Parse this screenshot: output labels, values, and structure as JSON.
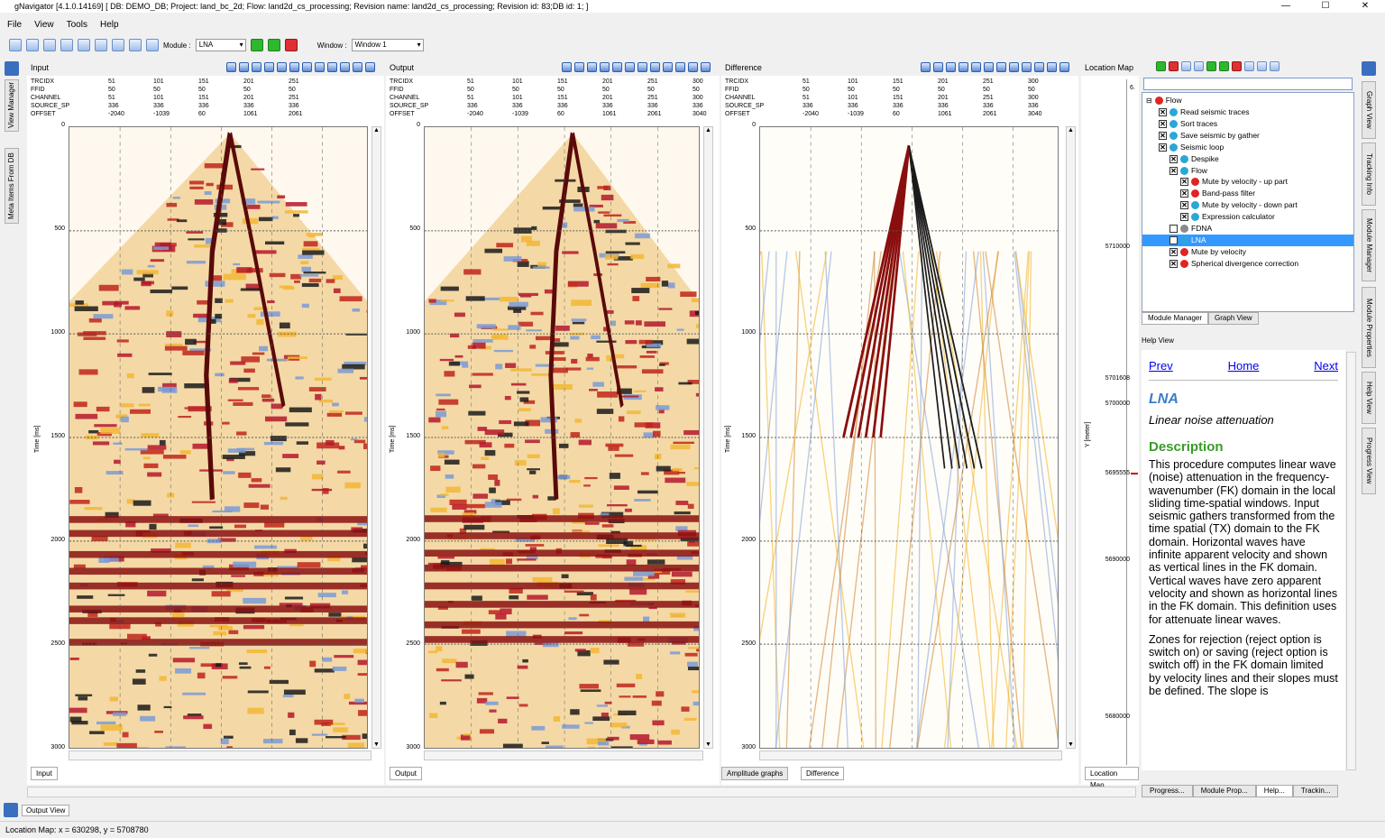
{
  "window": {
    "title": "gNavigator [4.1.0.14169] [ DB: DEMO_DB; Project: land_bc_2d; Flow: land2d_cs_processing; Revision name: land2d_cs_processing; Revision id: 83;DB id: 1; ]"
  },
  "menu": [
    "File",
    "View",
    "Tools",
    "Help"
  ],
  "toolbar": {
    "module_label": "Module :",
    "module_value": "LNA",
    "window_label": "Window :",
    "window_value": "Window 1"
  },
  "left_tabs": [
    "View Manager",
    "Meta Items From DB"
  ],
  "headers_keys": [
    "TRCIDX",
    "FFID",
    "CHANNEL",
    "SOURCE_SP",
    "OFFSET"
  ],
  "panels": [
    {
      "title": "Input",
      "tab": "Input",
      "values": [
        [
          "51",
          "101",
          "151",
          "201",
          "251"
        ],
        [
          "50",
          "50",
          "50",
          "50",
          "50"
        ],
        [
          "51",
          "101",
          "151",
          "201",
          "251"
        ],
        [
          "336",
          "336",
          "336",
          "336",
          "336"
        ],
        [
          "-2040",
          "-1039",
          "60",
          "1061",
          "2061"
        ]
      ]
    },
    {
      "title": "Output",
      "tab": "Output",
      "values": [
        [
          "51",
          "101",
          "151",
          "201",
          "251",
          "300"
        ],
        [
          "50",
          "50",
          "50",
          "50",
          "50",
          "50"
        ],
        [
          "51",
          "101",
          "151",
          "201",
          "251",
          "300"
        ],
        [
          "336",
          "336",
          "336",
          "336",
          "336",
          "336"
        ],
        [
          "-2040",
          "-1039",
          "60",
          "1061",
          "2061",
          "3040"
        ]
      ]
    },
    {
      "title": "Difference",
      "tabs": [
        "Amplitude graphs",
        "Difference"
      ],
      "values": [
        [
          "51",
          "101",
          "151",
          "201",
          "251",
          "300"
        ],
        [
          "50",
          "50",
          "50",
          "50",
          "50",
          "50"
        ],
        [
          "51",
          "101",
          "151",
          "201",
          "251",
          "300"
        ],
        [
          "336",
          "336",
          "336",
          "336",
          "336",
          "336"
        ],
        [
          "-2040",
          "-1039",
          "60",
          "1061",
          "2061",
          "3040"
        ]
      ]
    }
  ],
  "time_axis": {
    "label": "Time [ms]",
    "ticks": [
      "0",
      "500",
      "1000",
      "1500",
      "2000",
      "2500",
      "3000"
    ]
  },
  "location_map": {
    "title": "Location Map",
    "tab": "Location Map",
    "ylabel": "Y [meter]",
    "ticks": [
      "5710000",
      "5701608",
      "5700000",
      "5695555",
      "5690000",
      "5680000"
    ],
    "edge_label": "6."
  },
  "flow_tree": {
    "root": "Flow",
    "items": [
      {
        "label": "Read seismic traces",
        "status": "ok",
        "level": 1
      },
      {
        "label": "Sort traces",
        "status": "ok",
        "level": 1
      },
      {
        "label": "Save seismic by gather",
        "status": "ok",
        "level": 1
      },
      {
        "label": "Seismic loop",
        "status": "ok",
        "level": 1
      },
      {
        "label": "Despike",
        "status": "ok",
        "level": 2
      },
      {
        "label": "Flow",
        "status": "ok",
        "level": 2
      },
      {
        "label": "Mute by velocity - up part",
        "status": "err",
        "level": 3
      },
      {
        "label": "Band-pass filter",
        "status": "err",
        "level": 3
      },
      {
        "label": "Mute by velocity - down part",
        "status": "ok",
        "level": 3
      },
      {
        "label": "Expression calculator",
        "status": "ok",
        "level": 3
      },
      {
        "label": "FDNA",
        "status": "off",
        "level": 2
      },
      {
        "label": "LNA",
        "status": "ok",
        "level": 2,
        "selected": true
      },
      {
        "label": "Mute by velocity",
        "status": "err",
        "level": 2
      },
      {
        "label": "Spherical divergence correction",
        "status": "err",
        "level": 2
      }
    ],
    "tabs": [
      "Module Manager",
      "Graph View"
    ]
  },
  "help": {
    "title": "Help View",
    "nav": [
      "Prev",
      "Home",
      "Next"
    ],
    "heading": "LNA",
    "subtitle": "Linear noise attenuation",
    "section": "Description",
    "para1": "This procedure computes linear wave (noise) attenuation in the frequency-wavenumber (FK) domain in the local sliding time-spatial windows. Input seismic gathers transformed from the time spatial (TX) domain to the FK domain. Horizontal waves have infinite apparent velocity and shown as vertical lines in the FK domain. Vertical waves have zero apparent velocity and shown as horizontal lines in the FK domain. This definition uses for attenuate linear waves.",
    "para2": "Zones for rejection (reject option is switch on) or saving (reject option is switch off) in the FK domain limited by velocity lines and their slopes must be defined. The slope is"
  },
  "right_tabs": [
    "Graph View",
    "Tracking Info",
    "Module Manager",
    "Module Properties",
    "Help View",
    "Progress View"
  ],
  "bottom_right_tabs": [
    "Progress...",
    "Module Prop...",
    "Help...",
    "Trackin..."
  ],
  "output_view": "Output View",
  "status": "Location Map:  x = 630298, y = 5708780",
  "colors": {
    "selection": "#3399ff",
    "ok": "#2aa7d6",
    "err": "#e02424",
    "help_heading": "#3a7ec8",
    "help_section": "#3a9a2a"
  }
}
